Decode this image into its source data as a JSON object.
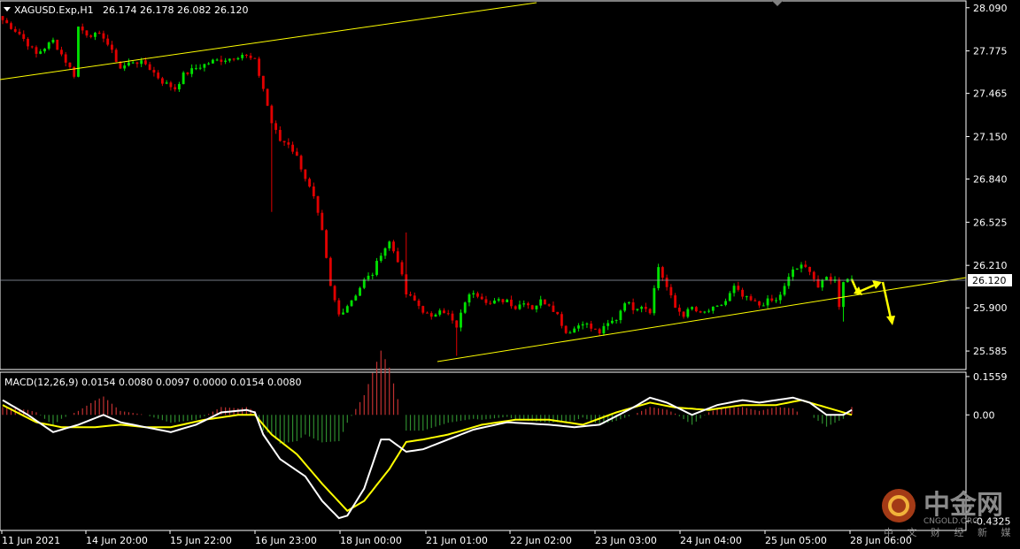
{
  "header": {
    "symbol_label": "XAGUSD.Exp,H1",
    "ohlc": "26.174 26.178 26.082 26.120"
  },
  "macd": {
    "label": "MACD(12,26,9) 0.0154 0.0080 0.0097 0.0000 0.0154 0.0080"
  },
  "colors": {
    "background": "#000000",
    "bull": "#00e000",
    "bear": "#e00000",
    "trendline": "#ffff00",
    "macd_line": "#ffffff",
    "signal_line": "#ffff00",
    "hist_pos": "#c03030",
    "hist_neg": "#2e8b2e"
  },
  "watermark": {
    "cn": "中金网",
    "en": "CNGOLD.ORG",
    "sub": "中 文 财 经 新 媒 体"
  },
  "chart_data": [
    {
      "type": "candlestick",
      "symbol": "XAGUSD.Exp",
      "timeframe": "H1",
      "ylim": [
        25.45,
        28.14
      ],
      "current_price": 26.12,
      "y_ticks": [
        "28.090",
        "27.775",
        "27.465",
        "27.150",
        "26.840",
        "26.525",
        "26.210",
        "25.900",
        "25.585"
      ],
      "current_price_label": "26.120",
      "x_ticks": [
        "11 Jun 2021",
        "14 Jun 20:00",
        "15 Jun 22:00",
        "16 Jun 23:00",
        "18 Jun 00:00",
        "21 Jun 01:00",
        "22 Jun 02:00",
        "23 Jun 03:00",
        "24 Jun 04:00",
        "25 Jun 05:00",
        "28 Jun 06:00"
      ],
      "close_path": [
        [
          0,
          28.0
        ],
        [
          4,
          27.9
        ],
        [
          8,
          27.75
        ],
        [
          12,
          27.85
        ],
        [
          15,
          27.7
        ],
        [
          17,
          27.6
        ],
        [
          18,
          27.95
        ],
        [
          20,
          27.9
        ],
        [
          24,
          27.88
        ],
        [
          28,
          27.65
        ],
        [
          31,
          27.7
        ],
        [
          34,
          27.68
        ],
        [
          38,
          27.55
        ],
        [
          41,
          27.5
        ],
        [
          43,
          27.6
        ],
        [
          46,
          27.65
        ],
        [
          50,
          27.7
        ],
        [
          54,
          27.72
        ],
        [
          57,
          27.75
        ],
        [
          60,
          27.7
        ],
        [
          62,
          27.5
        ],
        [
          64,
          27.25
        ],
        [
          66,
          27.12
        ],
        [
          68,
          27.1
        ],
        [
          70,
          27.0
        ],
        [
          72,
          26.85
        ],
        [
          74,
          26.7
        ],
        [
          76,
          26.45
        ],
        [
          78,
          26.05
        ],
        [
          80,
          25.85
        ],
        [
          82,
          25.92
        ],
        [
          84,
          26.0
        ],
        [
          86,
          26.1
        ],
        [
          88,
          26.15
        ],
        [
          90,
          26.3
        ],
        [
          92,
          26.38
        ],
        [
          94,
          26.25
        ],
        [
          96,
          26.0
        ],
        [
          98,
          25.95
        ],
        [
          100,
          25.88
        ],
        [
          102,
          25.82
        ],
        [
          104,
          25.9
        ],
        [
          106,
          25.85
        ],
        [
          108,
          25.75
        ],
        [
          110,
          25.95
        ],
        [
          112,
          26.02
        ],
        [
          114,
          25.98
        ],
        [
          116,
          25.93
        ],
        [
          118,
          25.95
        ],
        [
          120,
          25.96
        ],
        [
          122,
          25.9
        ],
        [
          124,
          25.95
        ],
        [
          126,
          25.9
        ],
        [
          128,
          25.95
        ],
        [
          130,
          25.93
        ],
        [
          132,
          25.85
        ],
        [
          134,
          25.72
        ],
        [
          136,
          25.75
        ],
        [
          138,
          25.8
        ],
        [
          140,
          25.75
        ],
        [
          142,
          25.72
        ],
        [
          144,
          25.78
        ],
        [
          146,
          25.82
        ],
        [
          148,
          25.95
        ],
        [
          150,
          25.9
        ],
        [
          152,
          25.92
        ],
        [
          154,
          25.88
        ],
        [
          156,
          26.2
        ],
        [
          158,
          26.05
        ],
        [
          160,
          25.9
        ],
        [
          162,
          25.85
        ],
        [
          164,
          25.9
        ],
        [
          166,
          25.85
        ],
        [
          168,
          25.88
        ],
        [
          170,
          25.9
        ],
        [
          172,
          25.95
        ],
        [
          174,
          26.05
        ],
        [
          176,
          25.98
        ],
        [
          178,
          25.95
        ],
        [
          180,
          25.92
        ],
        [
          182,
          25.95
        ],
        [
          184,
          25.95
        ],
        [
          186,
          26.05
        ],
        [
          188,
          26.18
        ],
        [
          190,
          26.2
        ],
        [
          192,
          26.18
        ],
        [
          194,
          26.05
        ],
        [
          196,
          26.12
        ],
        [
          198,
          26.1
        ],
        [
          199,
          25.92
        ],
        [
          200,
          26.1
        ],
        [
          202,
          26.12
        ]
      ],
      "wick_spikes": [
        [
          64,
          26.6
        ],
        [
          108,
          25.55
        ],
        [
          200,
          25.8
        ],
        [
          96,
          26.45
        ]
      ]
    },
    {
      "type": "line",
      "title": "MACD(12,26,9)",
      "ylim": [
        -0.47,
        0.17
      ],
      "y_ticks": [
        "0.1559",
        "0.00",
        "-0.4325"
      ],
      "series": [
        {
          "name": "MACD",
          "points": [
            [
              0,
              0.06
            ],
            [
              6,
              0.0
            ],
            [
              12,
              -0.07
            ],
            [
              18,
              -0.04
            ],
            [
              24,
              0.0
            ],
            [
              28,
              -0.03
            ],
            [
              34,
              -0.05
            ],
            [
              40,
              -0.07
            ],
            [
              46,
              -0.04
            ],
            [
              52,
              0.01
            ],
            [
              58,
              0.02
            ],
            [
              60,
              0.01
            ],
            [
              62,
              -0.08
            ],
            [
              66,
              -0.18
            ],
            [
              72,
              -0.25
            ],
            [
              76,
              -0.35
            ],
            [
              80,
              -0.42
            ],
            [
              82,
              -0.41
            ],
            [
              86,
              -0.3
            ],
            [
              90,
              -0.1
            ],
            [
              92,
              -0.1
            ],
            [
              96,
              -0.15
            ],
            [
              100,
              -0.14
            ],
            [
              106,
              -0.1
            ],
            [
              112,
              -0.06
            ],
            [
              120,
              -0.03
            ],
            [
              130,
              -0.04
            ],
            [
              136,
              -0.05
            ],
            [
              142,
              -0.04
            ],
            [
              150,
              0.03
            ],
            [
              154,
              0.07
            ],
            [
              158,
              0.05
            ],
            [
              164,
              0.0
            ],
            [
              170,
              0.04
            ],
            [
              176,
              0.06
            ],
            [
              180,
              0.05
            ],
            [
              184,
              0.06
            ],
            [
              188,
              0.07
            ],
            [
              192,
              0.05
            ],
            [
              196,
              0.0
            ],
            [
              200,
              0.0
            ],
            [
              202,
              0.02
            ]
          ]
        },
        {
          "name": "Signal",
          "points": [
            [
              0,
              0.04
            ],
            [
              8,
              -0.03
            ],
            [
              14,
              -0.05
            ],
            [
              22,
              -0.05
            ],
            [
              28,
              -0.04
            ],
            [
              34,
              -0.05
            ],
            [
              40,
              -0.05
            ],
            [
              48,
              -0.02
            ],
            [
              56,
              0.0
            ],
            [
              60,
              0.0
            ],
            [
              64,
              -0.08
            ],
            [
              70,
              -0.16
            ],
            [
              76,
              -0.28
            ],
            [
              82,
              -0.39
            ],
            [
              86,
              -0.35
            ],
            [
              92,
              -0.22
            ],
            [
              96,
              -0.11
            ],
            [
              100,
              -0.1
            ],
            [
              106,
              -0.08
            ],
            [
              114,
              -0.04
            ],
            [
              122,
              -0.02
            ],
            [
              130,
              -0.02
            ],
            [
              138,
              -0.04
            ],
            [
              146,
              0.01
            ],
            [
              154,
              0.05
            ],
            [
              160,
              0.03
            ],
            [
              168,
              0.02
            ],
            [
              176,
              0.04
            ],
            [
              184,
              0.04
            ],
            [
              190,
              0.06
            ],
            [
              196,
              0.03
            ],
            [
              202,
              0.0
            ]
          ]
        }
      ]
    }
  ]
}
